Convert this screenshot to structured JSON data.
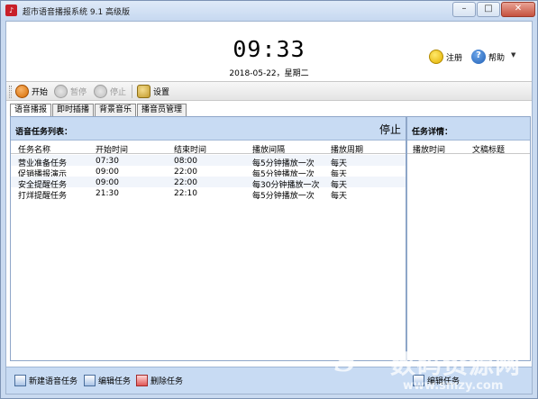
{
  "window": {
    "title": "超市语音播报系统 9.1 高级版",
    "controls": {
      "minimize": "–",
      "maximize": "□",
      "close": "✕"
    }
  },
  "header": {
    "time": "09:33",
    "date": "2018-05-22，星期二",
    "register_label": "注册",
    "help_label": "帮助",
    "menu_arrow": "▼"
  },
  "toolbar": {
    "start_label": "开始",
    "pause_label": "暂停",
    "stop_label": "停止",
    "settings_label": "设置"
  },
  "tabs": [
    {
      "label": "语音播报",
      "active": true
    },
    {
      "label": "即时插播",
      "active": false
    },
    {
      "label": "背景音乐",
      "active": false
    },
    {
      "label": "播音员管理",
      "active": false
    }
  ],
  "task_list": {
    "title": "语音任务列表：",
    "status": "停止",
    "columns": [
      "任务名称",
      "开始时间",
      "结束时间",
      "播放间隔",
      "播放周期"
    ],
    "rows": [
      [
        "营业准备任务",
        "07:30",
        "08:00",
        "每5分钟播放一次",
        "每天"
      ],
      [
        "促销播报演示",
        "09:00",
        "22:00",
        "每5分钟播放一次",
        "每天"
      ],
      [
        "安全提醒任务",
        "09:00",
        "22:00",
        "每30分钟播放一次",
        "每天"
      ],
      [
        "打烊提醒任务",
        "21:30",
        "22:10",
        "每5分钟播放一次",
        "每天"
      ]
    ]
  },
  "task_detail": {
    "title": "任务详情：",
    "columns": [
      "播放时间",
      "文稿标题"
    ]
  },
  "bottom_bar": {
    "new_task_label": "新建语音任务",
    "edit_task_label": "编辑任务",
    "delete_task_label": "删除任务",
    "edit_task_label_right": "编辑任务"
  },
  "watermark": {
    "logo": "S",
    "text": "数码资源网",
    "url": "www.smzy.com"
  },
  "colors": {
    "panel_header": "#c8dbf3",
    "window_frame": "#c9daf0",
    "start_icon": "#d66b00"
  }
}
